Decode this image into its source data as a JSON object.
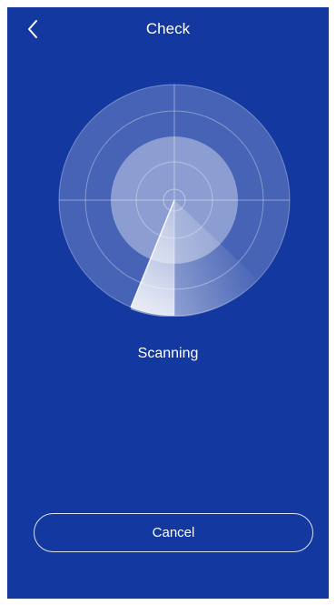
{
  "header": {
    "title": "Check",
    "back_icon": "chevron-left-icon"
  },
  "scanner": {
    "status": "Scanning",
    "icon": "radar-icon"
  },
  "footer": {
    "cancel_label": "Cancel"
  },
  "colors": {
    "background": "#1338a0",
    "text": "#ffffff"
  }
}
